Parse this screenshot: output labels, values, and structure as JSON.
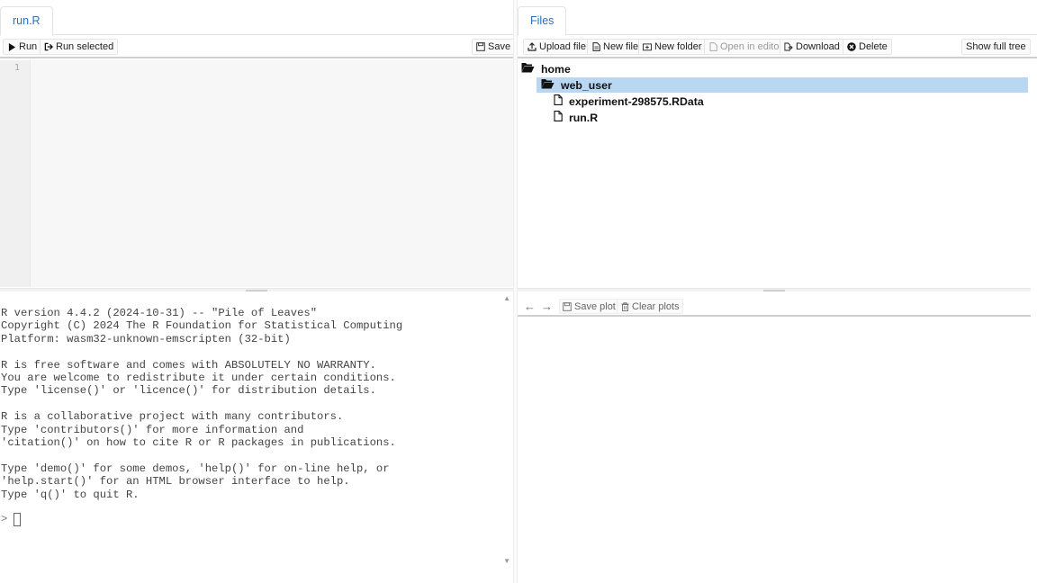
{
  "editor": {
    "tab_label": "run.R",
    "toolbar": {
      "run_label": "Run",
      "run_selected_label": "Run selected",
      "save_label": "Save"
    },
    "line_number": "1"
  },
  "console": {
    "output": "R version 4.4.2 (2024-10-31) -- \"Pile of Leaves\"\nCopyright (C) 2024 The R Foundation for Statistical Computing\nPlatform: wasm32-unknown-emscripten (32-bit)\n\nR is free software and comes with ABSOLUTELY NO WARRANTY.\nYou are welcome to redistribute it under certain conditions.\nType 'license()' or 'licence()' for distribution details.\n\nR is a collaborative project with many contributors.\nType 'contributors()' for more information and\n'citation()' on how to cite R or R packages in publications.\n\nType 'demo()' for some demos, 'help()' for on-line help, or\n'help.start()' for an HTML browser interface to help.\nType 'q()' to quit R.",
    "prompt": ">"
  },
  "files": {
    "tab_label": "Files",
    "toolbar": {
      "upload_label": "Upload file",
      "new_file_label": "New file",
      "new_folder_label": "New folder",
      "open_in_editor_label": "Open in editor",
      "download_label": "Download",
      "delete_label": "Delete",
      "show_full_tree_label": "Show full tree"
    },
    "tree": {
      "root": "home",
      "folder": "web_user",
      "files": [
        "experiment-298575.RData",
        "run.R"
      ]
    }
  },
  "plots": {
    "save_plot_label": "Save plot",
    "clear_plots_label": "Clear plots"
  },
  "colors": {
    "tab_text": "#2f6fb3",
    "selected_row": "#b9d7f3"
  }
}
